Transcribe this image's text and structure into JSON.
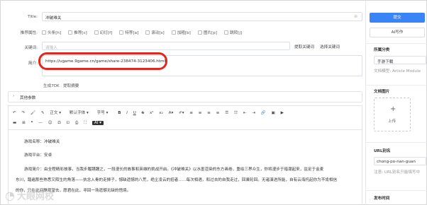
{
  "form": {
    "title_label": "Title:",
    "title_value": "冲破难关",
    "attr_label": "推荐属性:",
    "attrs": [
      "头条[h]",
      "推荐[c]",
      "幻灯[f]",
      "特荐[a]",
      "滚动[s]",
      "加粗[b]",
      "图片[p]",
      "跳转[j]"
    ],
    "keyword_label": "关键词:",
    "keyword_placeholder": "请输入",
    "extract_keyword": "提取关键词",
    "select_keyword": "选择关键词",
    "summary_label": "简介:",
    "summary_value": "https://ugame.9game.cn/game/share-238474-3123406.html",
    "generate_7dk": "生成7DK",
    "extract_summary": "提取摘要",
    "other_params": "其他参数"
  },
  "toolbar": {
    "para_label": "正文",
    "font_label": "默认字体",
    "size_label": "字号",
    "ai_label": "AI"
  },
  "content": {
    "line1": "游戏名称：冲破难关",
    "line2": "游戏平台：安卓",
    "line3": "游戏简介：由全程精彩故事，当我步履蹒跚之，一段漫长的故事和英雄的挑战开启。《冲破难关》以水墨渲染的东方画卷，重绘三界众生，你将漫步于暗潮起来，驻足于金麦",
    "line4": "东川，踏遍那些熟悉又陌生的角落——执念入骨的走狮子，憾缺遗憾的八荒，绝尘凌云的招者……每次相遇，和过去的自我走过，回乘轮回。无诸演进所能，自有云海托起你为不肯相信",
    "line5": "的你，只在此间静观望去，愿君在此，寻回一场遗憾无缺的悟境。"
  },
  "sidebar": {
    "submit": "提交",
    "ai_write": "AI写作",
    "category_title": "所属分类",
    "category_value": "手游下载",
    "doc_model": "文档模型: Article Module",
    "doc_image_title": "文档图片",
    "upload": "上传",
    "url_alias_title": "URL别名",
    "url_alias_value": "chong-po-nan-guan",
    "url_hint": "注意: URL别名只能填写中",
    "publish_time_title": "发布时间"
  },
  "watermark": "大眼网校",
  "colors": {
    "primary": "#3a84f7",
    "highlight": "#e0291e"
  }
}
